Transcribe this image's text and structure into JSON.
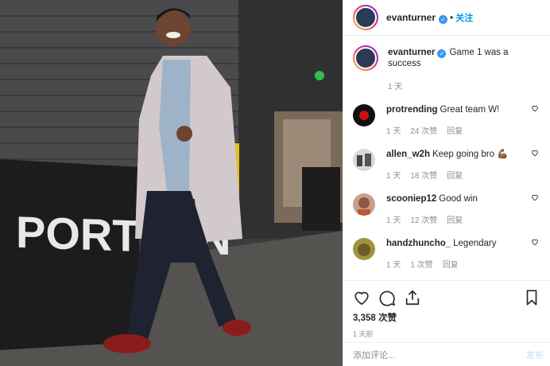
{
  "post": {
    "author": "evanturner",
    "follow_label": "关注",
    "dot": "•",
    "caption_text": "Game 1 was a success",
    "caption_time": "1 天",
    "likes": "3,358 次赞",
    "posted_ago": "1 天前",
    "add_comment_placeholder": "添加评论...",
    "post_label": "发布",
    "photo_sign_text": "PORTLAN"
  },
  "comments": [
    {
      "user": "protrending",
      "text": "Great team W!",
      "time": "1 天",
      "likes": "24 次赞",
      "reply": "回复",
      "avatar_color": "#111111"
    },
    {
      "user": "allen_w2h",
      "text": "Keep going bro 💪🏾",
      "time": "1 天",
      "likes": "18 次赞",
      "reply": "回复",
      "avatar_color": "#5a5a5a"
    },
    {
      "user": "scooniep12",
      "text": "Good win",
      "time": "1 天",
      "likes": "12 次赞",
      "reply": "回复",
      "avatar_color": "#b77a66"
    },
    {
      "user": "handzhuncho_",
      "text": "Legendary",
      "time": "1 天",
      "likes": "1 次赞",
      "reply": "回复",
      "avatar_color": "#8a7a3a"
    }
  ],
  "colors": {
    "link": "#0095f6",
    "verified": "#3897f0",
    "muted": "#8e8e8e"
  }
}
